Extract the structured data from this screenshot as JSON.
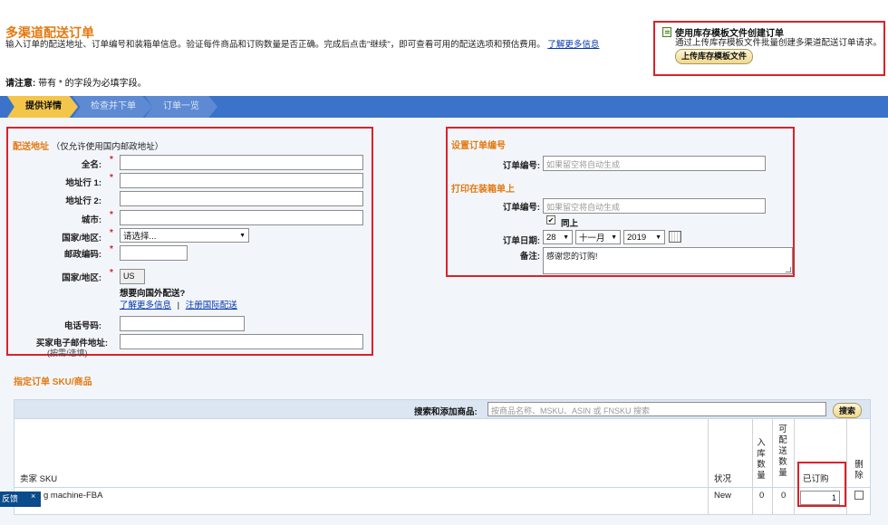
{
  "page": {
    "title": "多渠道配送订单",
    "intro": "输入订单的配送地址、订单编号和装箱单信息。验证每件商品和订购数量是否正确。完成后点击\"继续\"，即可查看可用的配送选项和预估费用。",
    "intro_link": "了解更多信息",
    "note_label": "请注意:",
    "note_text": " 带有 * 的字段为必填字段。"
  },
  "template_panel": {
    "title": "使用库存模板文件创建订单",
    "desc": "通过上传库存模板文件批量创建多渠道配送订单请求。",
    "button": "上传库存模板文件",
    "icon": "document-icon"
  },
  "steps": [
    {
      "label": "提供详情",
      "active": true
    },
    {
      "label": "检查并下单",
      "active": false
    },
    {
      "label": "订单一览",
      "active": false
    }
  ],
  "address": {
    "title": "配送地址",
    "subtitle": "（仅允许使用国内邮政地址）",
    "labels": {
      "name": "全名:",
      "line1": "地址行 1:",
      "line2": "地址行 2:",
      "city": "城市:",
      "region": "国家/地区:",
      "zip": "邮政编码:",
      "country": "国家/地区:",
      "phone": "电话号码:",
      "email": "买家电子邮件地址:",
      "email_hint": "(按需/选填)"
    },
    "required_mark": "*",
    "region_select": "请选择...",
    "country_value": "US",
    "intl_question": "想要向国外配送?",
    "learn_more": "了解更多信息",
    "separator": "|",
    "register_intl": "注册国际配送"
  },
  "order": {
    "set_id_title": "设置订单编号",
    "order_id_label": "订单编号:",
    "order_id_placeholder": "如果留空将自动生成",
    "print_title": "打印在装箱单上",
    "packing_id_label": "订单编号:",
    "packing_id_placeholder": "如果留空将自动生成",
    "same_checkbox": "同上",
    "check_mark": "✔",
    "date_label": "订单日期:",
    "date_day": "28",
    "date_month": "十一月",
    "date_year": "2019",
    "notes_label": "备注:",
    "notes_value": "感谢您的订购!"
  },
  "sku": {
    "title": "指定订单 SKU/商品",
    "search_label": "搜索和添加商品:",
    "search_placeholder": "按商品名称、MSKU、ASIN 或 FNSKU 搜索",
    "search_button": "搜索",
    "headers": {
      "seller_sku": "卖家 SKU",
      "status": "状况",
      "inbound": "入库数量",
      "available": "可配送数量",
      "ordered": "已订购",
      "delete": "删除"
    },
    "rows": [
      {
        "sku": "g machine-FBA",
        "status": "New",
        "inbound": "0",
        "available": "0",
        "ordered": "1"
      }
    ]
  },
  "feedback": {
    "label": "反馈",
    "close": "×"
  },
  "colors": {
    "accent": "#e47911",
    "stepbar": "#3a73c9",
    "highlight": "#d9222a",
    "panel": "#f2f6fb"
  }
}
